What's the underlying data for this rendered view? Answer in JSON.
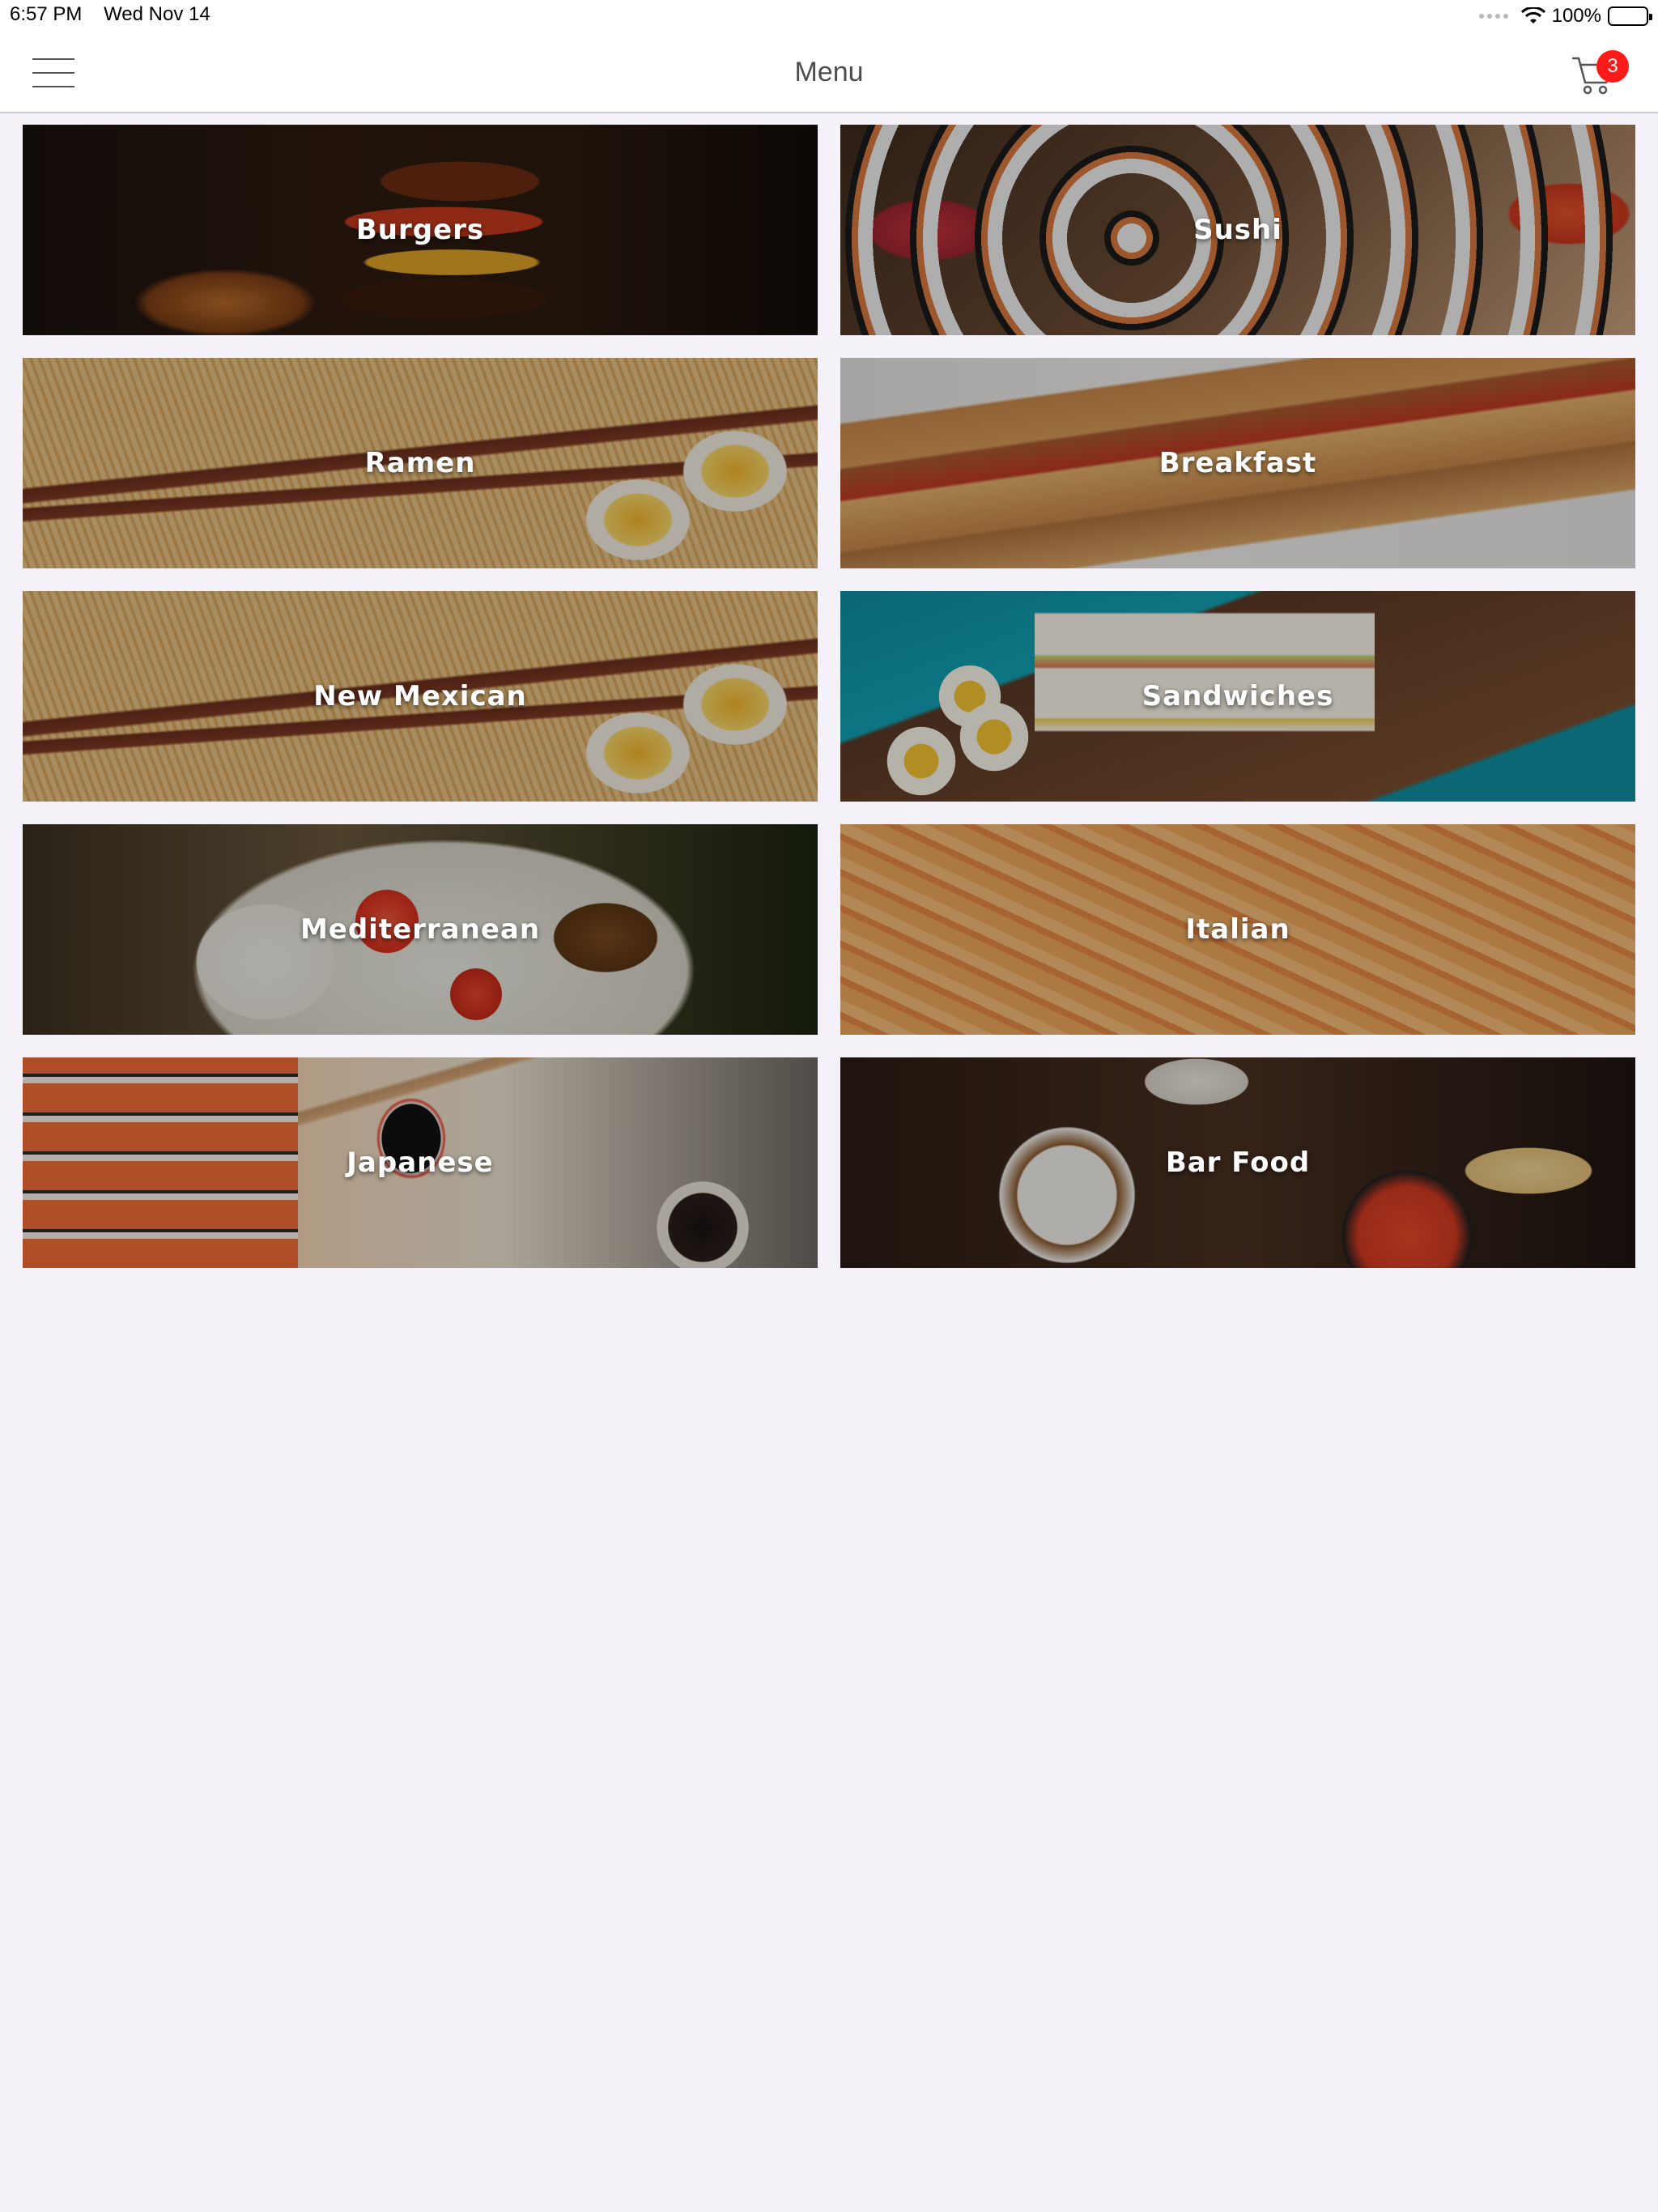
{
  "status_bar": {
    "time": "6:57 PM",
    "date": "Wed Nov 14",
    "battery_percent": "100%",
    "battery_level": 1.0
  },
  "nav": {
    "title": "Menu",
    "menu_icon": "hamburger-icon",
    "cart_icon": "cart-icon",
    "cart_count": "3"
  },
  "categories": [
    {
      "label": "Burgers"
    },
    {
      "label": "Sushi"
    },
    {
      "label": "Ramen"
    },
    {
      "label": "Breakfast"
    },
    {
      "label": "New Mexican"
    },
    {
      "label": "Sandwiches"
    },
    {
      "label": "Mediterranean"
    },
    {
      "label": "Italian"
    },
    {
      "label": "Japanese"
    },
    {
      "label": "Bar Food"
    }
  ],
  "colors": {
    "background": "#f4f2f8",
    "badge": "#ff1a1a",
    "nav_title": "#4d4d4d",
    "tile_text": "#ffffff"
  }
}
